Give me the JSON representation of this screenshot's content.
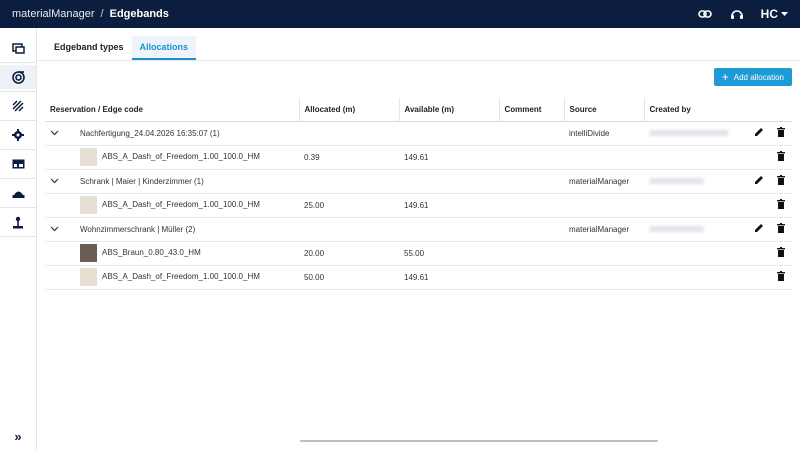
{
  "header": {
    "app_name": "materialManager",
    "separator": "/",
    "page": "Edgebands",
    "brand": "HC",
    "icons": [
      "link-icon",
      "support-icon",
      "brand-menu-icon"
    ]
  },
  "sidebar": {
    "items": [
      "panels-icon",
      "edgeband-icon",
      "hatch-icon",
      "gear-icon",
      "table-icon",
      "machine-icon",
      "joystick-icon"
    ],
    "expand": "»"
  },
  "tabs": [
    {
      "label": "Edgeband types",
      "active": false
    },
    {
      "label": "Allocations",
      "active": true
    }
  ],
  "add_button": {
    "label": "Add allocation"
  },
  "table": {
    "headers": [
      "Reservation / Edge code",
      "Allocated (m)",
      "Available (m)",
      "Comment",
      "Source",
      "Created by"
    ],
    "rows": [
      {
        "type": "group",
        "label": "Nachfertigung_24.04.2026 16:35:07 (1)",
        "source": "intelliDivide"
      },
      {
        "type": "item",
        "code": "ABS_A_Dash_of_Freedom_1.00_100.0_HM",
        "allocated": "0.39",
        "available": "149.61",
        "swatch": "#e6e0d4"
      },
      {
        "type": "group",
        "label": "Schrank | Maier | Kinderzimmer (1)",
        "source": "materialManager"
      },
      {
        "type": "item",
        "code": "ABS_A_Dash_of_Freedom_1.00_100.0_HM",
        "allocated": "25.00",
        "available": "149.61",
        "swatch": "#e6e0d4"
      },
      {
        "type": "group",
        "label": "Wohnzimmerschrank | Müller (2)",
        "source": "materialManager"
      },
      {
        "type": "item",
        "code": "ABS_Braun_0.80_43.0_HM",
        "allocated": "20.00",
        "available": "55.00",
        "swatch": "#6b5e55"
      },
      {
        "type": "item",
        "code": "ABS_A_Dash_of_Freedom_1.00_100.0_HM",
        "allocated": "50.00",
        "available": "149.61",
        "swatch": "#e6e0d4"
      }
    ]
  }
}
